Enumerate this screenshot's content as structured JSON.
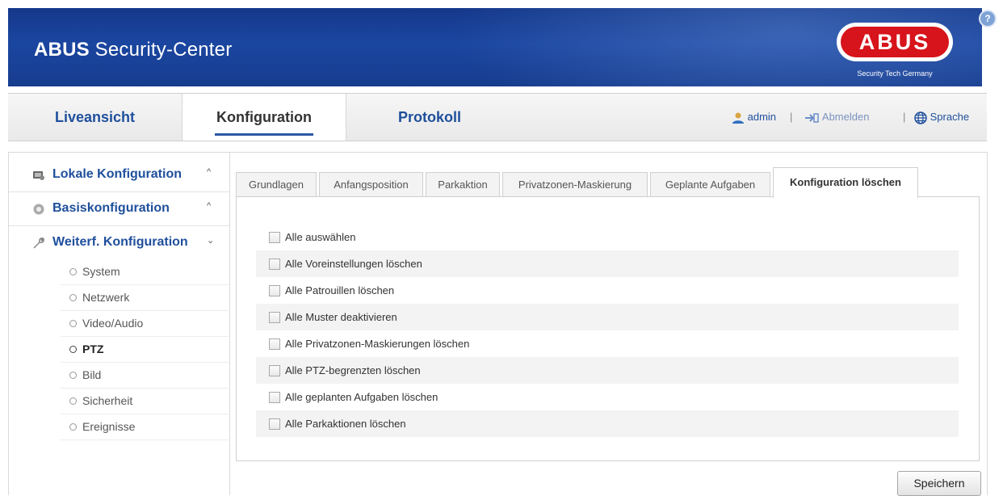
{
  "header": {
    "title_bold": "ABUS",
    "title_rest": " Security-Center",
    "logo_text": "ABUS",
    "logo_tagline": "Security Tech Germany",
    "help_icon": "?"
  },
  "nav": {
    "tabs": [
      {
        "label": "Liveansicht"
      },
      {
        "label": "Konfiguration"
      },
      {
        "label": "Protokoll"
      }
    ],
    "user": "admin",
    "separator": "|",
    "logout": "Abmelden",
    "language": "Sprache"
  },
  "sidebar": {
    "sections": [
      {
        "label": "Lokale Konfiguration",
        "icon": "local-config-icon"
      },
      {
        "label": "Basiskonfiguration",
        "icon": "gear-icon"
      },
      {
        "label": "Weiterf. Konfiguration",
        "icon": "wrench-icon"
      }
    ],
    "items": [
      {
        "label": "System"
      },
      {
        "label": "Netzwerk"
      },
      {
        "label": "Video/Audio"
      },
      {
        "label": "PTZ"
      },
      {
        "label": "Bild"
      },
      {
        "label": "Sicherheit"
      },
      {
        "label": "Ereignisse"
      }
    ]
  },
  "tabs": [
    {
      "label": "Grundlagen"
    },
    {
      "label": "Anfangsposition"
    },
    {
      "label": "Parkaktion"
    },
    {
      "label": "Privatzonen-Maskierung"
    },
    {
      "label": "Geplante Aufgaben"
    },
    {
      "label": "Konfiguration löschen"
    }
  ],
  "options": [
    {
      "label": "Alle auswählen"
    },
    {
      "label": "Alle Voreinstellungen löschen"
    },
    {
      "label": "Alle Patrouillen löschen"
    },
    {
      "label": "Alle Muster deaktivieren"
    },
    {
      "label": "Alle Privatzonen-Maskierungen löschen"
    },
    {
      "label": "Alle PTZ-begrenzten löschen"
    },
    {
      "label": "Alle geplanten Aufgaben löschen"
    },
    {
      "label": "Alle Parkaktionen löschen"
    }
  ],
  "save_label": "Speichern",
  "colors": {
    "header_blue": "#1b46a0",
    "link_blue": "#1f4f9c",
    "logo_red": "#d7131b"
  }
}
